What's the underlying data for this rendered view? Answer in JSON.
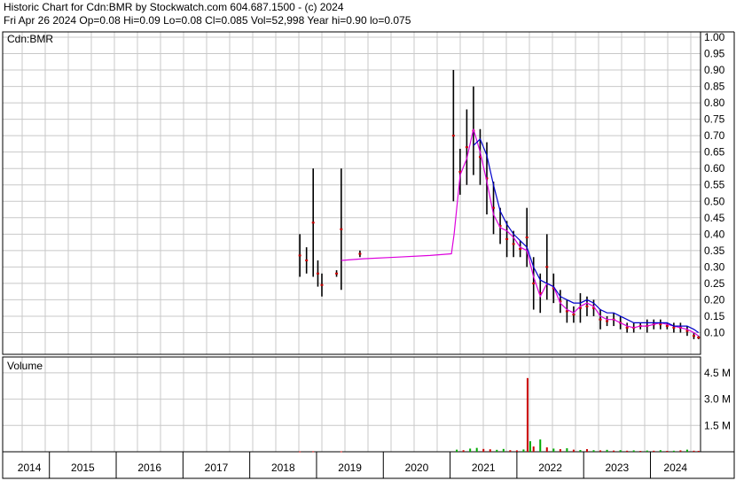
{
  "header": {
    "line1": "Historic Chart for Cdn:BMR by Stockwatch.com 604.687.1500 - (c) 2024",
    "line2": "Fri Apr 26 2024   Op=0.08   Hi=0.09   Lo=0.08   Cl=0.085   Vol=52,998   Year hi=0.90   lo=0.075"
  },
  "colors": {
    "price_bar": "#000000",
    "price_marker": "#cc0000",
    "ma_short": "#dd00dd",
    "ma_long": "#0000cc",
    "volume_up": "#00aa00",
    "volume_down": "#cc0000",
    "grid": "#c8c8c8"
  },
  "chart_data": [
    {
      "type": "line",
      "title": "Cdn:BMR",
      "y_axis_side": "right",
      "ylim": [
        0.05,
        1.0
      ],
      "y_ticks": [
        "1.00",
        "0.95",
        "0.90",
        "0.85",
        "0.80",
        "0.75",
        "0.70",
        "0.65",
        "0.60",
        "0.55",
        "0.50",
        "0.45",
        "0.40",
        "0.35",
        "0.30",
        "0.25",
        "0.20",
        "0.15",
        "0.10"
      ],
      "grid": true,
      "series": [
        {
          "kind": "price_range",
          "points": [
            {
              "x": 2018.35,
              "lo": 0.27,
              "hi": 0.4
            },
            {
              "x": 2018.45,
              "lo": 0.28,
              "hi": 0.36
            },
            {
              "x": 2018.55,
              "lo": 0.27,
              "hi": 0.6
            },
            {
              "x": 2018.62,
              "lo": 0.24,
              "hi": 0.32
            },
            {
              "x": 2018.68,
              "lo": 0.21,
              "hi": 0.28
            },
            {
              "x": 2018.9,
              "lo": 0.27,
              "hi": 0.29
            },
            {
              "x": 2018.97,
              "lo": 0.23,
              "hi": 0.6
            },
            {
              "x": 2019.25,
              "lo": 0.33,
              "hi": 0.35
            },
            {
              "x": 2020.65,
              "lo": 0.5,
              "hi": 0.9
            },
            {
              "x": 2020.75,
              "lo": 0.52,
              "hi": 0.66
            },
            {
              "x": 2020.85,
              "lo": 0.55,
              "hi": 0.78
            },
            {
              "x": 2020.95,
              "lo": 0.58,
              "hi": 0.85
            },
            {
              "x": 2021.05,
              "lo": 0.55,
              "hi": 0.72
            },
            {
              "x": 2021.15,
              "lo": 0.46,
              "hi": 0.68
            },
            {
              "x": 2021.25,
              "lo": 0.4,
              "hi": 0.56
            },
            {
              "x": 2021.35,
              "lo": 0.37,
              "hi": 0.48
            },
            {
              "x": 2021.45,
              "lo": 0.33,
              "hi": 0.44
            },
            {
              "x": 2021.55,
              "lo": 0.33,
              "hi": 0.41
            },
            {
              "x": 2021.65,
              "lo": 0.33,
              "hi": 0.38
            },
            {
              "x": 2021.75,
              "lo": 0.3,
              "hi": 0.48
            },
            {
              "x": 2021.85,
              "lo": 0.17,
              "hi": 0.33
            },
            {
              "x": 2021.95,
              "lo": 0.16,
              "hi": 0.28
            },
            {
              "x": 2022.05,
              "lo": 0.2,
              "hi": 0.4
            },
            {
              "x": 2022.15,
              "lo": 0.19,
              "hi": 0.28
            },
            {
              "x": 2022.25,
              "lo": 0.16,
              "hi": 0.23
            },
            {
              "x": 2022.35,
              "lo": 0.13,
              "hi": 0.2
            },
            {
              "x": 2022.45,
              "lo": 0.13,
              "hi": 0.18
            },
            {
              "x": 2022.55,
              "lo": 0.13,
              "hi": 0.22
            },
            {
              "x": 2022.65,
              "lo": 0.15,
              "hi": 0.21
            },
            {
              "x": 2022.75,
              "lo": 0.15,
              "hi": 0.2
            },
            {
              "x": 2022.85,
              "lo": 0.11,
              "hi": 0.17
            },
            {
              "x": 2022.95,
              "lo": 0.12,
              "hi": 0.15
            },
            {
              "x": 2023.05,
              "lo": 0.12,
              "hi": 0.16
            },
            {
              "x": 2023.15,
              "lo": 0.11,
              "hi": 0.15
            },
            {
              "x": 2023.25,
              "lo": 0.1,
              "hi": 0.13
            },
            {
              "x": 2023.35,
              "lo": 0.1,
              "hi": 0.13
            },
            {
              "x": 2023.45,
              "lo": 0.11,
              "hi": 0.13
            },
            {
              "x": 2023.55,
              "lo": 0.1,
              "hi": 0.14
            },
            {
              "x": 2023.65,
              "lo": 0.11,
              "hi": 0.14
            },
            {
              "x": 2023.75,
              "lo": 0.11,
              "hi": 0.14
            },
            {
              "x": 2023.85,
              "lo": 0.11,
              "hi": 0.13
            },
            {
              "x": 2023.95,
              "lo": 0.1,
              "hi": 0.13
            },
            {
              "x": 2024.05,
              "lo": 0.1,
              "hi": 0.13
            },
            {
              "x": 2024.15,
              "lo": 0.09,
              "hi": 0.12
            },
            {
              "x": 2024.25,
              "lo": 0.08,
              "hi": 0.1
            },
            {
              "x": 2024.32,
              "lo": 0.08,
              "hi": 0.09
            }
          ]
        },
        {
          "kind": "moving_average_short",
          "x": [
            2018.97,
            2019.3,
            2019.8,
            2020.3,
            2020.62,
            2020.66,
            2020.75,
            2020.85,
            2020.95,
            2021.05,
            2021.15,
            2021.25,
            2021.35,
            2021.45,
            2021.55,
            2021.65,
            2021.75,
            2021.85,
            2021.95,
            2022.05,
            2022.15,
            2022.25,
            2022.35,
            2022.45,
            2022.55,
            2022.65,
            2022.75,
            2022.85,
            2022.95,
            2023.05,
            2023.15,
            2023.25,
            2023.35,
            2023.45,
            2023.55,
            2023.65,
            2023.75,
            2023.85,
            2023.95,
            2024.05,
            2024.15,
            2024.25,
            2024.32
          ],
          "y": [
            0.32,
            0.325,
            0.33,
            0.335,
            0.34,
            0.4,
            0.58,
            0.63,
            0.72,
            0.65,
            0.56,
            0.46,
            0.42,
            0.41,
            0.39,
            0.36,
            0.35,
            0.27,
            0.21,
            0.25,
            0.24,
            0.19,
            0.17,
            0.16,
            0.18,
            0.19,
            0.18,
            0.15,
            0.14,
            0.14,
            0.13,
            0.12,
            0.115,
            0.12,
            0.12,
            0.125,
            0.13,
            0.125,
            0.12,
            0.115,
            0.11,
            0.1,
            0.09
          ]
        },
        {
          "kind": "moving_average_long",
          "x": [
            2020.95,
            2021.05,
            2021.15,
            2021.25,
            2021.35,
            2021.45,
            2021.55,
            2021.65,
            2021.75,
            2021.85,
            2021.95,
            2022.05,
            2022.15,
            2022.25,
            2022.35,
            2022.45,
            2022.55,
            2022.65,
            2022.75,
            2022.85,
            2022.95,
            2023.05,
            2023.15,
            2023.25,
            2023.35,
            2023.45,
            2023.55,
            2023.65,
            2023.75,
            2023.85,
            2023.95,
            2024.05,
            2024.15,
            2024.25,
            2024.32
          ],
          "y": [
            0.67,
            0.69,
            0.64,
            0.55,
            0.47,
            0.43,
            0.4,
            0.38,
            0.36,
            0.3,
            0.26,
            0.25,
            0.24,
            0.21,
            0.2,
            0.19,
            0.19,
            0.2,
            0.19,
            0.17,
            0.16,
            0.16,
            0.15,
            0.14,
            0.13,
            0.13,
            0.13,
            0.13,
            0.13,
            0.13,
            0.12,
            0.12,
            0.12,
            0.11,
            0.1
          ]
        }
      ]
    },
    {
      "type": "bar",
      "title": "Volume",
      "y_axis_side": "right",
      "ylim": [
        0,
        5200000
      ],
      "y_ticks": [
        "4.5 M",
        "3.0 M",
        "1.5 M"
      ],
      "y_tick_values": [
        4500000,
        3000000,
        1500000
      ],
      "grid": true,
      "series": [
        {
          "name": "Volume",
          "points": [
            {
              "x": 2018.35,
              "v": 20000,
              "dir": "down"
            },
            {
              "x": 2018.55,
              "v": 30000,
              "dir": "down"
            },
            {
              "x": 2018.97,
              "v": 25000,
              "dir": "down"
            },
            {
              "x": 2020.7,
              "v": 120000,
              "dir": "up"
            },
            {
              "x": 2020.8,
              "v": 90000,
              "dir": "down"
            },
            {
              "x": 2020.9,
              "v": 180000,
              "dir": "up"
            },
            {
              "x": 2021.0,
              "v": 220000,
              "dir": "up"
            },
            {
              "x": 2021.1,
              "v": 160000,
              "dir": "down"
            },
            {
              "x": 2021.2,
              "v": 140000,
              "dir": "down"
            },
            {
              "x": 2021.3,
              "v": 110000,
              "dir": "up"
            },
            {
              "x": 2021.4,
              "v": 160000,
              "dir": "up"
            },
            {
              "x": 2021.5,
              "v": 90000,
              "dir": "down"
            },
            {
              "x": 2021.6,
              "v": 80000,
              "dir": "down"
            },
            {
              "x": 2021.7,
              "v": 130000,
              "dir": "up"
            },
            {
              "x": 2021.76,
              "v": 4200000,
              "dir": "down"
            },
            {
              "x": 2021.8,
              "v": 600000,
              "dir": "up"
            },
            {
              "x": 2021.85,
              "v": 300000,
              "dir": "down"
            },
            {
              "x": 2021.95,
              "v": 700000,
              "dir": "up"
            },
            {
              "x": 2022.05,
              "v": 250000,
              "dir": "down"
            },
            {
              "x": 2022.15,
              "v": 180000,
              "dir": "up"
            },
            {
              "x": 2022.25,
              "v": 150000,
              "dir": "down"
            },
            {
              "x": 2022.35,
              "v": 200000,
              "dir": "up"
            },
            {
              "x": 2022.45,
              "v": 120000,
              "dir": "down"
            },
            {
              "x": 2022.55,
              "v": 100000,
              "dir": "up"
            },
            {
              "x": 2022.65,
              "v": 150000,
              "dir": "down"
            },
            {
              "x": 2022.75,
              "v": 90000,
              "dir": "up"
            },
            {
              "x": 2022.85,
              "v": 80000,
              "dir": "down"
            },
            {
              "x": 2022.95,
              "v": 110000,
              "dir": "up"
            },
            {
              "x": 2023.05,
              "v": 70000,
              "dir": "down"
            },
            {
              "x": 2023.15,
              "v": 90000,
              "dir": "up"
            },
            {
              "x": 2023.25,
              "v": 60000,
              "dir": "down"
            },
            {
              "x": 2023.35,
              "v": 80000,
              "dir": "up"
            },
            {
              "x": 2023.45,
              "v": 50000,
              "dir": "down"
            },
            {
              "x": 2023.55,
              "v": 70000,
              "dir": "up"
            },
            {
              "x": 2023.65,
              "v": 60000,
              "dir": "down"
            },
            {
              "x": 2023.75,
              "v": 90000,
              "dir": "up"
            },
            {
              "x": 2023.85,
              "v": 50000,
              "dir": "down"
            },
            {
              "x": 2023.95,
              "v": 60000,
              "dir": "up"
            },
            {
              "x": 2024.05,
              "v": 80000,
              "dir": "down"
            },
            {
              "x": 2024.15,
              "v": 120000,
              "dir": "up"
            },
            {
              "x": 2024.25,
              "v": 60000,
              "dir": "down"
            },
            {
              "x": 2024.32,
              "v": 53000,
              "dir": "down"
            }
          ]
        }
      ]
    }
  ],
  "x_axis": {
    "years": [
      "2014",
      "2015",
      "2016",
      "2017",
      "2018",
      "2019",
      "2020",
      "2021",
      "2022",
      "2023",
      "2024"
    ],
    "year_starts": [
      2014.0,
      2014.6,
      2015.6,
      2016.6,
      2017.6,
      2018.6,
      2019.6,
      2020.6,
      2021.6,
      2022.6,
      2023.6
    ],
    "range": [
      2013.9,
      2024.35
    ]
  }
}
